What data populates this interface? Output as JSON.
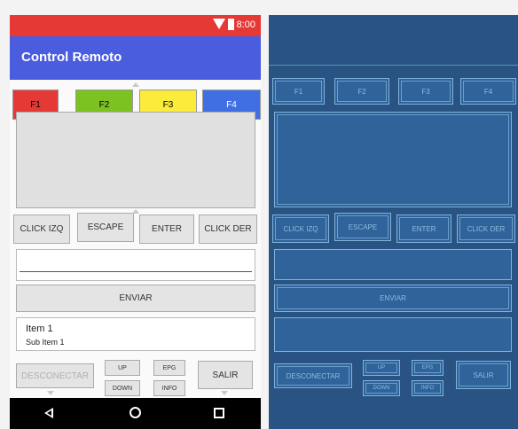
{
  "status_bar": {
    "time": "8:00"
  },
  "app_bar": {
    "title": "Control Remoto"
  },
  "function_buttons": [
    {
      "label": "F1",
      "color": "#e53935"
    },
    {
      "label": "F2",
      "color": "#7cc220"
    },
    {
      "label": "F3",
      "color": "#fbeb3b"
    },
    {
      "label": "F4",
      "color": "#3f6fe2"
    }
  ],
  "mouse_buttons": {
    "click_izq": "CLICK IZQ",
    "escape": "ESCAPE",
    "enter": "ENTER",
    "click_der": "CLICK DER"
  },
  "send_button": {
    "label": "ENVIAR"
  },
  "list": {
    "item_title": "Item 1",
    "item_subtitle": "Sub Item 1"
  },
  "bottom_controls": {
    "disconnect": "DESCONECTAR",
    "up": "UP",
    "down": "DOWN",
    "epg": "EPG",
    "info": "INFO",
    "exit": "SALIR"
  },
  "colors": {
    "status_bar": "#e53935",
    "app_bar": "#4a5ddf",
    "blueprint_bg": "#285382"
  }
}
